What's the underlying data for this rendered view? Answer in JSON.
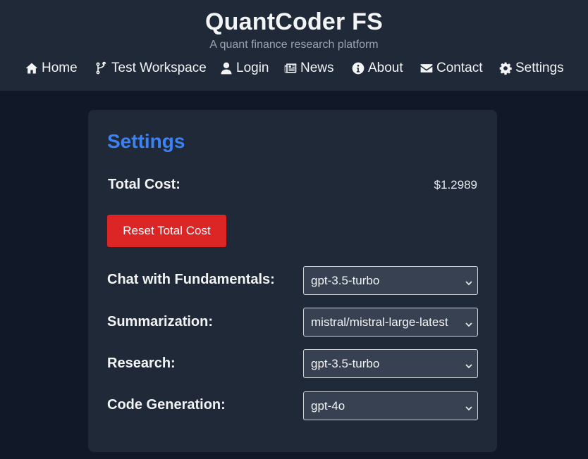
{
  "header": {
    "title": "QuantCoder FS",
    "tagline": "A quant finance research platform"
  },
  "nav": [
    {
      "label": "Home",
      "icon": "home-icon"
    },
    {
      "label": "Test Workspace",
      "icon": "code-branch-icon"
    },
    {
      "label": "Login",
      "icon": "user-icon"
    },
    {
      "label": "News",
      "icon": "newspaper-icon"
    },
    {
      "label": "About",
      "icon": "info-circle-icon"
    },
    {
      "label": "Contact",
      "icon": "envelope-icon"
    },
    {
      "label": "Settings",
      "icon": "gear-icon"
    }
  ],
  "settings": {
    "title": "Settings",
    "total_cost_label": "Total Cost:",
    "total_cost_value": "$1.2989",
    "reset_label": "Reset Total Cost",
    "rows": [
      {
        "label": "Chat with Fundamentals:",
        "value": "gpt-3.5-turbo"
      },
      {
        "label": "Summarization:",
        "value": "mistral/mistral-large-latest"
      },
      {
        "label": "Research:",
        "value": "gpt-3.5-turbo"
      },
      {
        "label": "Code Generation:",
        "value": "gpt-4o"
      }
    ]
  },
  "colors": {
    "page_bg": "#111827",
    "panel_bg": "#1f2937",
    "accent_blue": "#3b82f6",
    "danger_red": "#dc2626",
    "select_bg": "#374151"
  }
}
